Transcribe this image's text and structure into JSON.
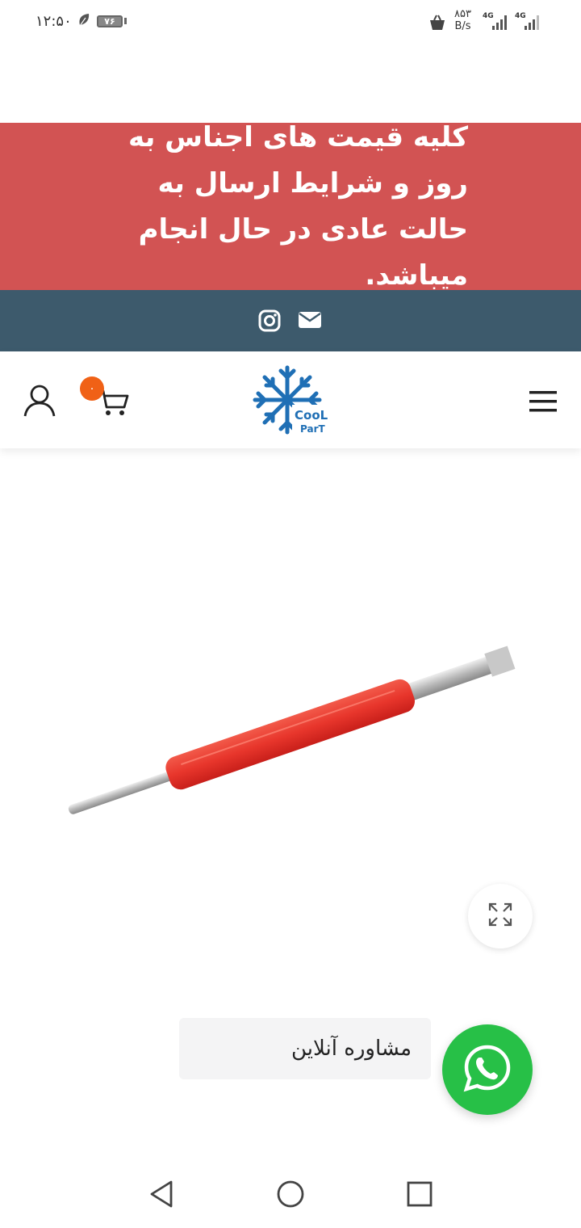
{
  "status_bar": {
    "time": "۱۲:۵۰",
    "battery": "۷۶",
    "speed_value": "۸۵۳",
    "speed_unit": "B/s",
    "signal_1": "4G",
    "signal_2": "4G"
  },
  "promo_banner": {
    "text": "کلیه قیمت های اجناس به روز و شرایط ارسال به حالت عادی در حال انجام میباشد.",
    "background": "#d25353"
  },
  "social_bar": {
    "background": "#3d5a6c",
    "icons": [
      "instagram-icon",
      "email-icon"
    ]
  },
  "header": {
    "cart_count": "۰",
    "logo_line1": "CooL",
    "logo_line2": "ParT",
    "logo_color": "#1f6fb5"
  },
  "product": {
    "image": "red-valve-core-tool"
  },
  "consultation": {
    "label": "مشاوره آنلاین",
    "button_color": "#27c047"
  },
  "nav_bar": {
    "icons": [
      "back-icon",
      "home-icon",
      "recents-icon"
    ]
  }
}
